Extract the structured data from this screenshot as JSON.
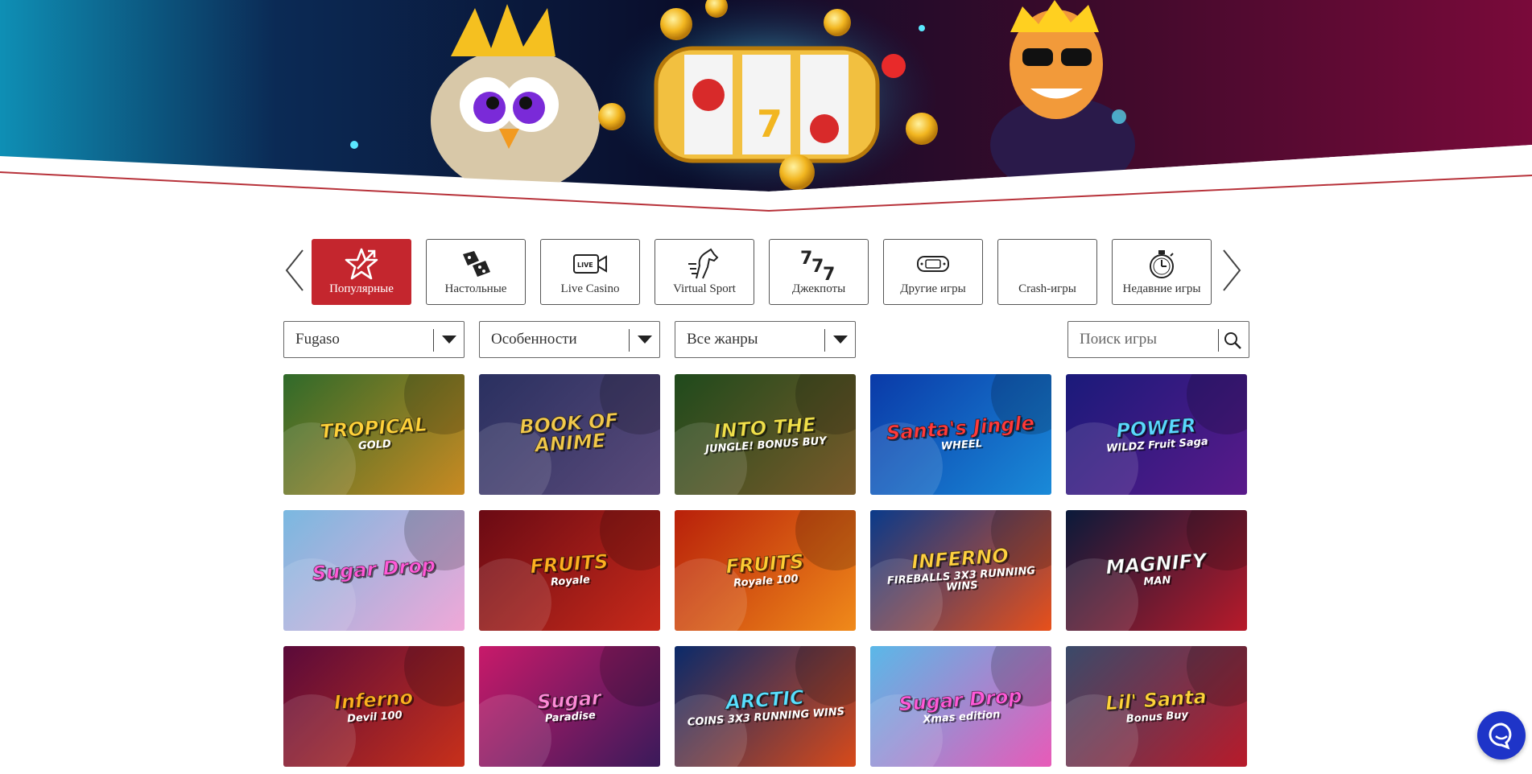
{
  "categories": {
    "items": [
      {
        "label": "Популярные",
        "icon": "star-icon",
        "active": true
      },
      {
        "label": "Настольные",
        "icon": "dice-icon",
        "active": false
      },
      {
        "label": "Live Casino",
        "icon": "live-camera-icon",
        "active": false
      },
      {
        "label": "Virtual Sport",
        "icon": "horse-icon",
        "active": false
      },
      {
        "label": "Джекпоты",
        "icon": "sevens-icon",
        "active": false
      },
      {
        "label": "Другие игры",
        "icon": "gamepad-icon",
        "active": false
      },
      {
        "label": "Crash-игры",
        "icon": "crash-icon",
        "active": false
      },
      {
        "label": "Недавние игры",
        "icon": "stopwatch-icon",
        "active": false
      }
    ],
    "jackpot_glyph": "7 7 7"
  },
  "filters": {
    "provider": "Fugaso",
    "features": "Особенности",
    "genres": "Все жанры",
    "search_placeholder": "Поиск игры"
  },
  "games": [
    {
      "line1": "TROPICAL",
      "line2": "GOLD",
      "bg": "#2f6a2a",
      "bg2": "#c98a22",
      "color": "#ffd23a"
    },
    {
      "line1": "BOOK OF ANIME",
      "line2": "",
      "bg": "#2a3060",
      "bg2": "#5a4a7a",
      "color": "#f2c94c"
    },
    {
      "line1": "INTO THE",
      "line2": "JUNGLE! BONUS BUY",
      "bg": "#1f4a1c",
      "bg2": "#7a5a2a",
      "color": "#f0e04a"
    },
    {
      "line1": "Santa's Jingle",
      "line2": "WHEEL",
      "bg": "#0a3aa8",
      "bg2": "#1a8ad8",
      "color": "#ff3b3b"
    },
    {
      "line1": "POWER",
      "line2": "WILDZ Fruit Saga",
      "bg": "#1a1a7a",
      "bg2": "#5a1a8a",
      "color": "#5ad8ff"
    },
    {
      "line1": "Sugar Drop",
      "line2": "",
      "bg": "#7ab8e0",
      "bg2": "#f0a8d8",
      "color": "#ff5ad8"
    },
    {
      "line1": "FRUITS",
      "line2": "Royale",
      "bg": "#6a0a14",
      "bg2": "#c82a1a",
      "color": "#ffb020"
    },
    {
      "line1": "FRUITS",
      "line2": "Royale 100",
      "bg": "#b8200a",
      "bg2": "#f08a1a",
      "color": "#ffcc33"
    },
    {
      "line1": "INFERNO",
      "line2": "FIREBALLS 3X3 RUNNING WINS",
      "bg": "#0a3a8a",
      "bg2": "#e8501a",
      "color": "#ffd040"
    },
    {
      "line1": "MAGNIFY",
      "line2": "MAN",
      "bg": "#0a1a3a",
      "bg2": "#b81a2a",
      "color": "#ffffff"
    },
    {
      "line1": "Inferno",
      "line2": "Devil 100",
      "bg": "#5a0a3a",
      "bg2": "#c8301a",
      "color": "#ffb020"
    },
    {
      "line1": "Sugar",
      "line2": "Paradise",
      "bg": "#c81a6a",
      "bg2": "#3a1a5a",
      "color": "#ff8ad8"
    },
    {
      "line1": "ARCTIC",
      "line2": "COINS 3X3 RUNNING WINS",
      "bg": "#0a2a6a",
      "bg2": "#d84a1a",
      "color": "#5ae0ff"
    },
    {
      "line1": "Sugar Drop",
      "line2": "Xmas edition",
      "bg": "#5ab8e8",
      "bg2": "#e85ab8",
      "color": "#ff5ad8"
    },
    {
      "line1": "Lil' Santa",
      "line2": "Bonus Buy",
      "bg": "#3a4a6a",
      "bg2": "#b81a2a",
      "color": "#ffd23a"
    }
  ],
  "colors": {
    "accent": "#c4262e",
    "chat": "#1e34c8"
  }
}
